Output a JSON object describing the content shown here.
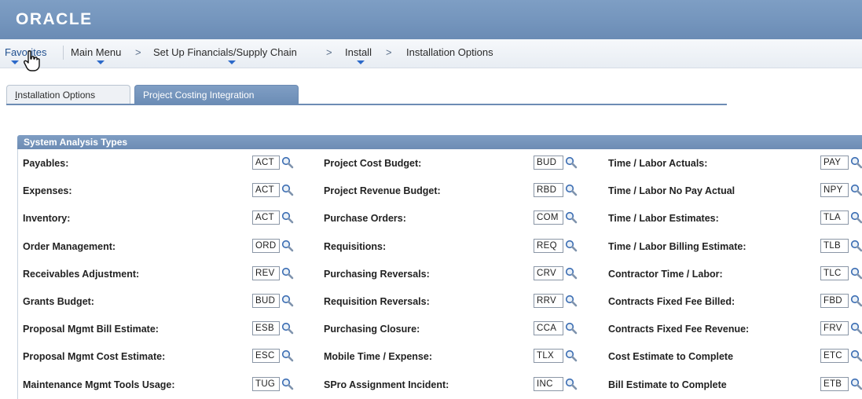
{
  "header": {
    "logo_text": "ORACLE"
  },
  "breadcrumb": {
    "favorites": "Favorites",
    "main_menu": "Main Menu",
    "setup": "Set Up Financials/Supply Chain",
    "install": "Install",
    "current": "Installation Options",
    "separator": ">"
  },
  "tabs": [
    {
      "label": "Installation Options",
      "underline_char": "I",
      "rest": "nstallation Options",
      "active": false
    },
    {
      "label": "Project Costing Integration",
      "active": true
    }
  ],
  "section": {
    "title": "System Analysis Types",
    "columns": [
      {
        "rows": [
          {
            "label": "Payables:",
            "value": "ACT"
          },
          {
            "label": "Expenses:",
            "value": "ACT"
          },
          {
            "label": "Inventory:",
            "value": "ACT"
          },
          {
            "label": "Order Management:",
            "value": "ORD"
          },
          {
            "label": "Receivables Adjustment:",
            "value": "REV"
          },
          {
            "label": "Grants Budget:",
            "value": "BUD"
          },
          {
            "label": "Proposal Mgmt Bill Estimate:",
            "value": "ESB"
          },
          {
            "label": "Proposal Mgmt Cost Estimate:",
            "value": "ESC"
          },
          {
            "label": "Maintenance Mgmt Tools Usage:",
            "value": "TUG"
          }
        ]
      },
      {
        "rows": [
          {
            "label": "Project Cost Budget:",
            "value": "BUD"
          },
          {
            "label": "Project Revenue Budget:",
            "value": "RBD"
          },
          {
            "label": "Purchase Orders:",
            "value": "COM"
          },
          {
            "label": "Requisitions:",
            "value": "REQ"
          },
          {
            "label": "Purchasing Reversals:",
            "value": "CRV"
          },
          {
            "label": "Requisition Reversals:",
            "value": "RRV"
          },
          {
            "label": "Purchasing Closure:",
            "value": "CCA"
          },
          {
            "label": "Mobile Time / Expense:",
            "value": "TLX"
          },
          {
            "label": "SPro Assignment Incident:",
            "value": "INC"
          }
        ]
      },
      {
        "rows": [
          {
            "label": "Time / Labor Actuals:",
            "value": "PAY"
          },
          {
            "label": "Time / Labor No Pay Actual",
            "value": "NPY"
          },
          {
            "label": "Time / Labor Estimates:",
            "value": "TLA"
          },
          {
            "label": "Time / Labor Billing Estimate:",
            "value": "TLB"
          },
          {
            "label": "Contractor Time / Labor:",
            "value": "TLC"
          },
          {
            "label": "Contracts Fixed Fee Billed:",
            "value": "FBD"
          },
          {
            "label": "Contracts Fixed Fee Revenue:",
            "value": "FRV"
          },
          {
            "label": "Cost Estimate to Complete",
            "value": "ETC"
          },
          {
            "label": "Bill Estimate to Complete",
            "value": "ETB"
          }
        ]
      }
    ]
  },
  "icons": {
    "lookup": "magnifier-lookup-icon",
    "cursor": "hand-pointer-icon"
  },
  "colors": {
    "banner": "#7394bc",
    "link": "#1f4f8f",
    "caret": "#2b69c9"
  }
}
